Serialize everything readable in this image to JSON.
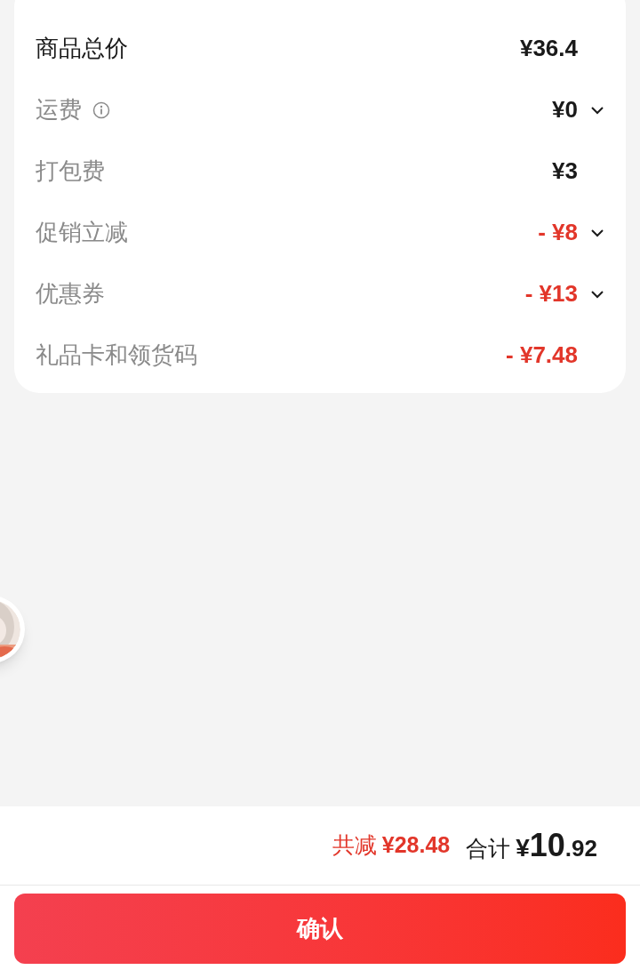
{
  "price_details": [
    {
      "label": "商品总价",
      "value": "¥36.4",
      "kind": "total",
      "info": false,
      "expandable": false
    },
    {
      "label": "运费",
      "value": "¥0",
      "kind": "fee",
      "info": true,
      "expandable": true
    },
    {
      "label": "打包费",
      "value": "¥3",
      "kind": "fee",
      "info": false,
      "expandable": false
    },
    {
      "label": "促销立减",
      "value": "- ¥8",
      "kind": "discount",
      "info": false,
      "expandable": true
    },
    {
      "label": "优惠券",
      "value": "- ¥13",
      "kind": "discount",
      "info": false,
      "expandable": true
    },
    {
      "label": "礼品卡和领货码",
      "value": "- ¥7.48",
      "kind": "discount",
      "info": false,
      "expandable": false
    }
  ],
  "footer": {
    "savings_label": "共减",
    "savings_amount": "¥28.48",
    "total_label": "合计",
    "total_currency": "¥",
    "total_integer": "10",
    "total_decimal": ".92",
    "confirm_button": "确认"
  }
}
